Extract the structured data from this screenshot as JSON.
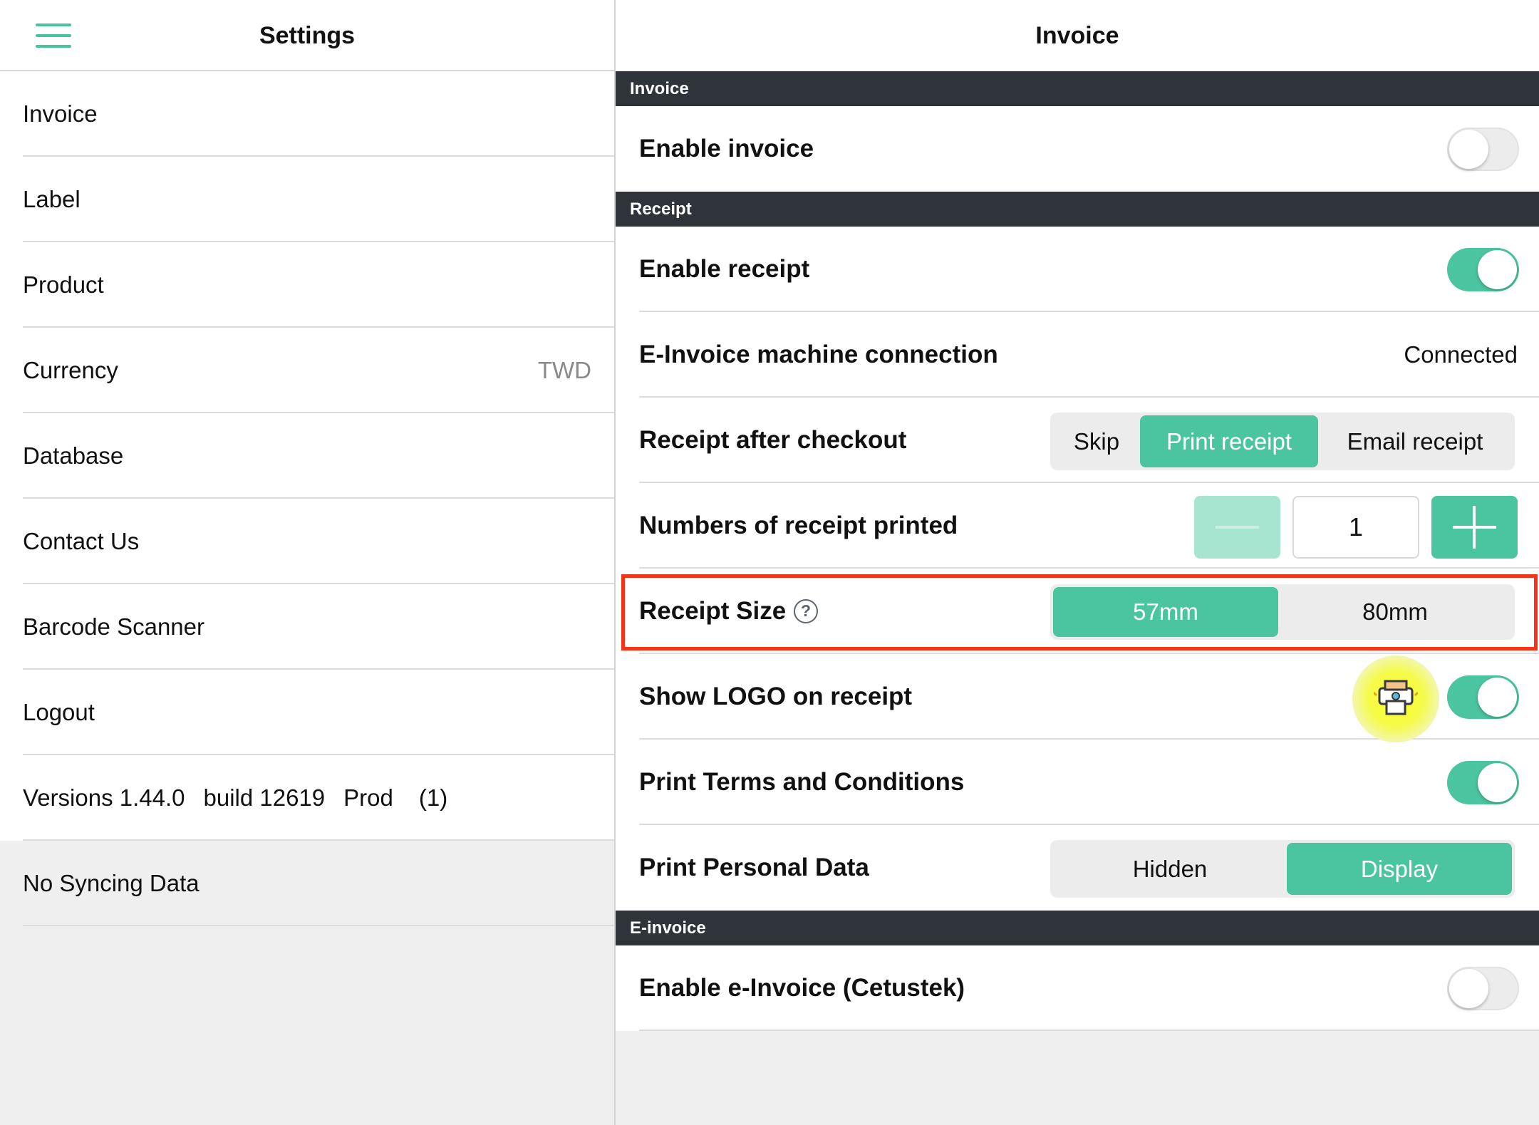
{
  "left": {
    "title": "Settings",
    "items": [
      {
        "label": "Invoice",
        "value": ""
      },
      {
        "label": "Label",
        "value": ""
      },
      {
        "label": "Product",
        "value": ""
      },
      {
        "label": "Currency",
        "value": "TWD"
      },
      {
        "label": "Database",
        "value": ""
      },
      {
        "label": "Contact Us",
        "value": ""
      },
      {
        "label": "Barcode Scanner",
        "value": ""
      },
      {
        "label": "Logout",
        "value": ""
      }
    ],
    "version": {
      "version": "Versions 1.44.0",
      "build": "build 12619",
      "env": "Prod",
      "count": "(1)"
    },
    "sync_status": "No Syncing Data"
  },
  "right": {
    "title": "Invoice",
    "sections": {
      "invoice": "Invoice",
      "receipt": "Receipt",
      "einvoice": "E-invoice"
    },
    "enable_invoice": {
      "label": "Enable invoice",
      "on": false
    },
    "enable_receipt": {
      "label": "Enable receipt",
      "on": true
    },
    "machine_connection": {
      "label": "E-Invoice machine connection",
      "value": "Connected"
    },
    "receipt_after_checkout": {
      "label": "Receipt after checkout",
      "options": [
        "Skip",
        "Print receipt",
        "Email receipt"
      ],
      "selected": "Print receipt"
    },
    "numbers_printed": {
      "label": "Numbers of receipt printed",
      "value": "1"
    },
    "receipt_size": {
      "label": "Receipt Size",
      "help": "?",
      "options": [
        "57mm",
        "80mm"
      ],
      "selected": "57mm"
    },
    "show_logo": {
      "label": "Show LOGO on receipt",
      "on": true
    },
    "print_terms": {
      "label": "Print Terms and Conditions",
      "on": true
    },
    "print_personal": {
      "label": "Print Personal Data",
      "options": [
        "Hidden",
        "Display"
      ],
      "selected": "Display"
    },
    "enable_einvoice": {
      "label": "Enable e-Invoice (Cetustek)",
      "on": false
    }
  },
  "colors": {
    "accent": "#4bc4a0",
    "section_bg": "#2f343b",
    "highlight": "#f53318"
  }
}
